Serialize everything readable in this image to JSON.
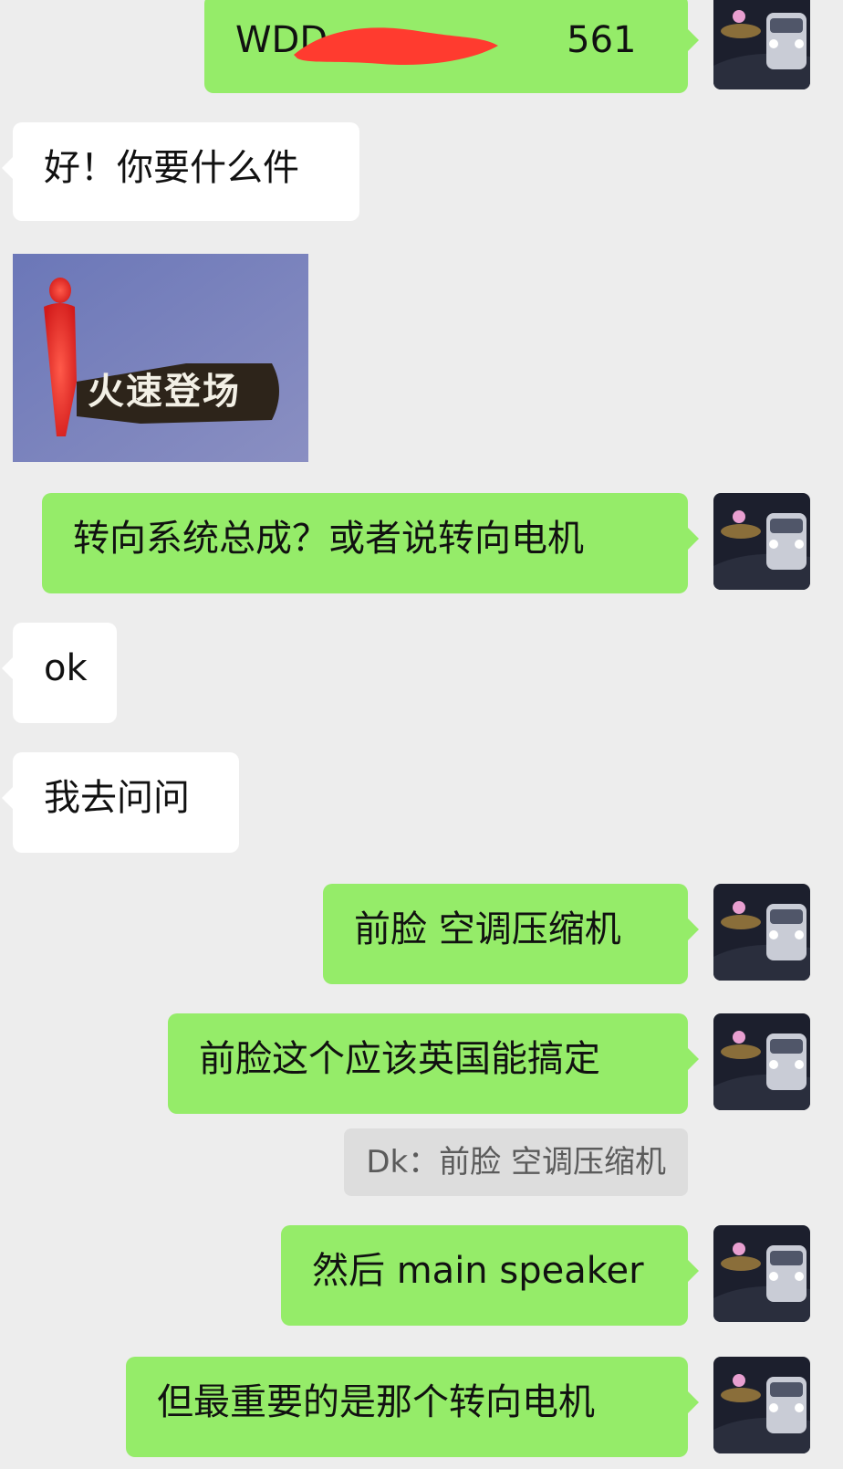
{
  "messages": {
    "m1": "WDD",
    "m1_tail": "561",
    "m2": "好！你要什么件",
    "m3": "转向系统总成？或者说转向电机",
    "m4": "ok",
    "m5": "我去问问",
    "m6": "前脸 空调压缩机",
    "m7": "前脸这个应该英国能搞定",
    "m8": "然后 main speaker",
    "m9": "但最重要的是那个转向电机"
  },
  "quote": "Dk：前脸 空调压缩机",
  "sticker": {
    "text": "火速登场"
  },
  "colors": {
    "background": "#ededed",
    "outgoing_bubble": "#95ec69",
    "incoming_bubble": "#ffffff",
    "quote_bg": "#dddddd",
    "redaction": "#ff3b2f"
  },
  "icons": {
    "avatar": "car-avatar-icon"
  }
}
